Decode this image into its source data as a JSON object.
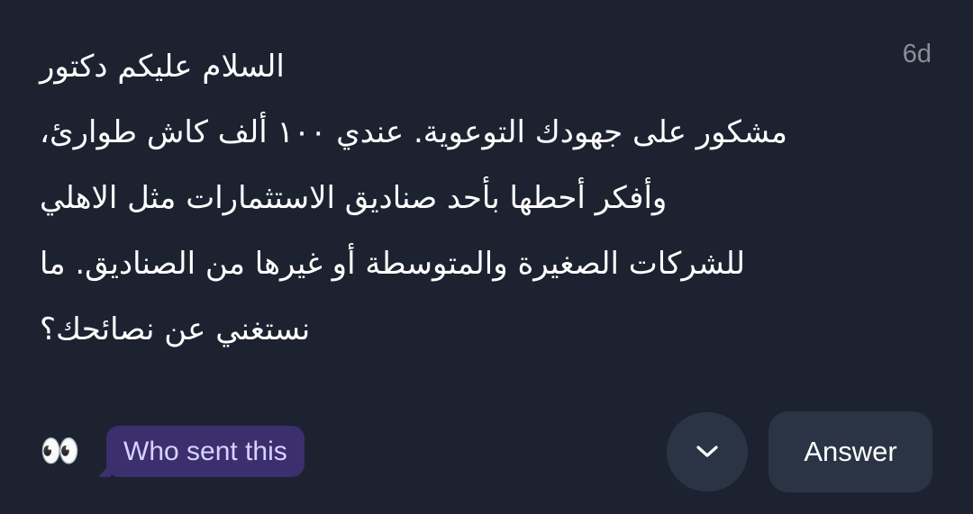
{
  "question": {
    "age": "6d",
    "lines": [
      "السلام عليكم دكتور",
      "مشكور على جهودك التوعوية. عندي ١٠٠ ألف كاش طوارئ،",
      "وأفكر أحطها بأحد صناديق الاستثمارات مثل الاهلي",
      "للشركات الصغيرة والمتوسطة أو غيرها من الصناديق. ما",
      "نستغني عن نصائحك؟"
    ]
  },
  "footer": {
    "emoji": "👀",
    "who_sent_label": "Who sent this",
    "expand_icon": "chevron-down-icon",
    "answer_label": "Answer"
  },
  "colors": {
    "background": "#1c2230",
    "button_bg": "#2b3445",
    "who_sent_bg": "#3c2f6e",
    "who_sent_text": "#d9d2ff",
    "muted_text": "#8b8f99"
  }
}
